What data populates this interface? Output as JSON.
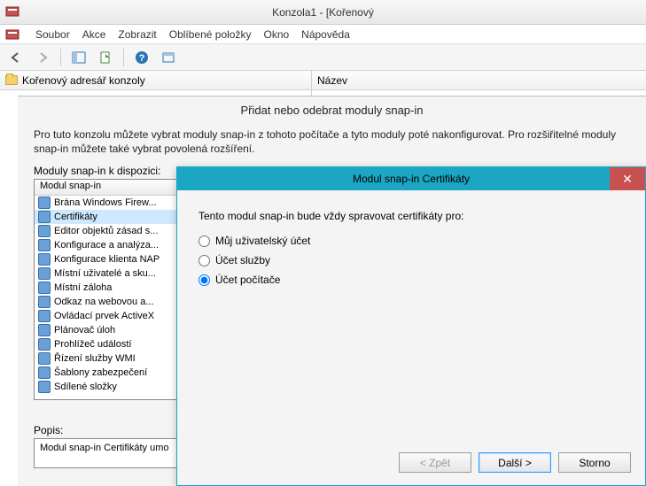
{
  "window": {
    "title": "Konzola1 - [Kořenový"
  },
  "menu": {
    "file": "Soubor",
    "action": "Akce",
    "view": "Zobrazit",
    "favorites": "Oblíbené položky",
    "window": "Okno",
    "help": "Nápověda"
  },
  "tree_header": "Kořenový adresář konzoly",
  "list_header": "Název",
  "snapin_dialog": {
    "title": "Přidat nebo odebrat moduly snap-in",
    "description": "Pro tuto konzolu můžete vybrat moduly snap-in z tohoto počítače a tyto moduly poté nakonfigurovat. Pro rozšiřitelné moduly snap-in můžete také vybrat povolená rozšíření.",
    "available_label": "Moduly snap-in k dispozici:",
    "col_header": "Modul snap-in",
    "items": [
      "Brána Windows Firew...",
      "Certifikáty",
      "Editor objektů zásad s...",
      "Konfigurace a analýza...",
      "Konfigurace klienta NAP",
      "Místní uživatelé a sku...",
      "Místní záloha",
      "Odkaz na webovou a...",
      "Ovládací prvek ActiveX",
      "Plánovač úloh",
      "Prohlížeč událostí",
      "Řízení služby WMI",
      "Šablony zabezpečení",
      "Sdílené složky"
    ],
    "selected_index": 1,
    "desc_label": "Popis:",
    "desc_text": "Modul snap-in Certifikáty umo"
  },
  "cert_dialog": {
    "title": "Modul snap-in Certifikáty",
    "intro": "Tento modul snap-in bude vždy spravovat certifikáty pro:",
    "options": {
      "user": "Můj uživatelský účet",
      "service": "Účet služby",
      "computer": "Účet počítače"
    },
    "selected": "computer",
    "buttons": {
      "back": "< Zpět",
      "next": "Další >",
      "cancel": "Storno"
    }
  }
}
